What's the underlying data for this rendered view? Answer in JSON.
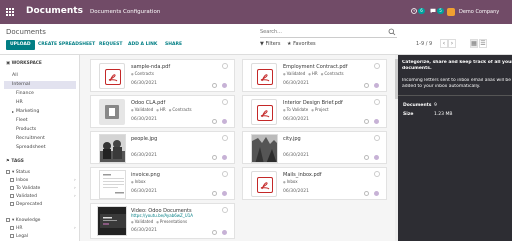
{
  "navbar": {
    "app_title": "Documents",
    "menu": [
      "Documents",
      "Configuration"
    ],
    "activity_count": "6",
    "message_count": "5",
    "company": "Demo Company"
  },
  "control": {
    "breadcrumb": "Documents",
    "buttons": [
      "UPLOAD",
      "CREATE SPREADSHEET",
      "REQUEST",
      "ADD A LINK",
      "SHARE"
    ],
    "search_placeholder": "Search...",
    "filters": "Filters",
    "favorites": "Favorites",
    "pager": "1-9 / 9"
  },
  "sidebar": {
    "workspace_title": "WORKSPACE",
    "workspaces": [
      "All",
      "Internal",
      "Finance",
      "HR",
      "Marketing",
      "Fleet",
      "Products",
      "Recruitment",
      "Spreadsheet"
    ],
    "tags_title": "TAGS",
    "status_title": "Status",
    "status_items": [
      "Inbox",
      "To Validate",
      "Validated",
      "Deprecated"
    ],
    "knowledge_title": "Knowledge",
    "knowledge_items": [
      "HR",
      "Legal"
    ]
  },
  "documents": [
    {
      "name": "sample-nda.pdf",
      "tags": [
        "Contracts"
      ],
      "date": "06/30/2021",
      "kind": "pdf"
    },
    {
      "name": "Employment Contract.pdf",
      "tags": [
        "Validated",
        "HR",
        "Contracts"
      ],
      "date": "06/30/2021",
      "kind": "pdf"
    },
    {
      "name": "Odoo CLA.pdf",
      "tags": [
        "Validated",
        "HR",
        "Contracts"
      ],
      "date": "06/30/2021",
      "kind": "generic"
    },
    {
      "name": "Interior Design Brief.pdf",
      "tags": [
        "To Validate",
        "Project"
      ],
      "date": "06/30/2021",
      "kind": "pdf"
    },
    {
      "name": "people.jpg",
      "tags": [],
      "date": "06/30/2021",
      "kind": "photo"
    },
    {
      "name": "city.jpg",
      "tags": [],
      "date": "06/30/2021",
      "kind": "photo"
    },
    {
      "name": "invoice.png",
      "tags": [
        "Inbox"
      ],
      "date": "06/30/2021",
      "kind": "invoice"
    },
    {
      "name": "Mails_inbox.pdf",
      "tags": [
        "Inbox"
      ],
      "date": "06/30/2021",
      "kind": "pdf"
    },
    {
      "name": "Video: Odoo Documents",
      "url": "https://youtu.be/Ayab6wZ_U1A",
      "tags": [
        "Validated",
        "Presentations"
      ],
      "date": "06/30/2021",
      "kind": "video"
    }
  ],
  "panel": {
    "intro": [
      "Categorize, share and keep track of all your interna",
      "documents.",
      "",
      "Incoming letters sent to inbox email alias will be",
      "added to your inbox automatically."
    ],
    "documents_label": "Documents",
    "documents_value": "9",
    "size_label": "Size",
    "size_value": "1.23 MB"
  },
  "colors": {
    "brand": "#714b67",
    "accent": "#017e84",
    "pdf_red": "#c42828",
    "panel_bg": "#2d2d33"
  }
}
